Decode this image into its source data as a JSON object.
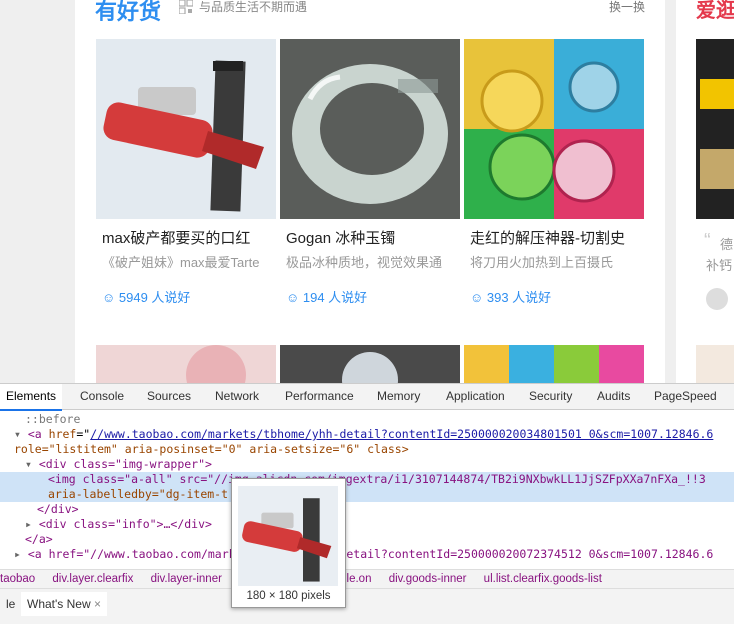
{
  "module": {
    "title": "有好货",
    "subtitle": "与品质生活不期而遇",
    "more": "换一换",
    "right_title": "爱逛街"
  },
  "cards": [
    {
      "title": "max破产都要买的口红",
      "desc": "《破产姐妹》max最爱Tarte",
      "likes": "☺ 5949 人说好"
    },
    {
      "title": "Gogan 冰种玉镯",
      "desc": "极品冰种质地，视觉效果通",
      "likes": "☺ 194 人说好"
    },
    {
      "title": "走红的解压神器-切割史",
      "desc": "将刀用火加热到上百摄氏",
      "likes": "☺ 393 人说好"
    }
  ],
  "right_card": {
    "quote": "德",
    "desc": "补钙"
  },
  "devtools": {
    "tabs": [
      "Elements",
      "Console",
      "Sources",
      "Network",
      "Performance",
      "Memory",
      "Application",
      "Security",
      "Audits",
      "PageSpeed"
    ],
    "lines": {
      "before": "::before",
      "a1_tag": "<a",
      "a1_href_attr": "href",
      "a1_href_val": "//www.taobao.com/markets/tbhome/yhh-detail?contentId=250000020034801501 0&scm=1007.12846.6",
      "a1_role": "role=\"listitem\" aria-posinset=\"0\" aria-setsize=\"6\" class>",
      "div_open": "<div class=\"img-wrapper\">",
      "img_line": "<img class=\"a-all\" src=\"//img.alicdn.com/imgextra/i1/3107144874/TB2i9NXbwkLL1JjSZFpXXa7nFXa_!!3",
      "img_line2": "aria-labelledby=\"dg-item-t",
      "div_close": "</div>",
      "info_div": "<div class=\"info\">…</div>",
      "a_close": "</a>",
      "a2_line": "<a href=\"//www.taobao.com/markets/tbhome/yhh-detail?contentId=250000020072374512 0&scm=1007.12846.6"
    },
    "breadcrumbs": [
      "taobao",
      "div.layer.clearfix",
      "div.layer-inner",
      "cover-goods.J_Module.on",
      "div.goods-inner",
      "ul.list.clearfix.goods-list"
    ],
    "drawer_tabs": [
      "le",
      "What's New"
    ],
    "tooltip_size": "180 × 180 pixels"
  }
}
